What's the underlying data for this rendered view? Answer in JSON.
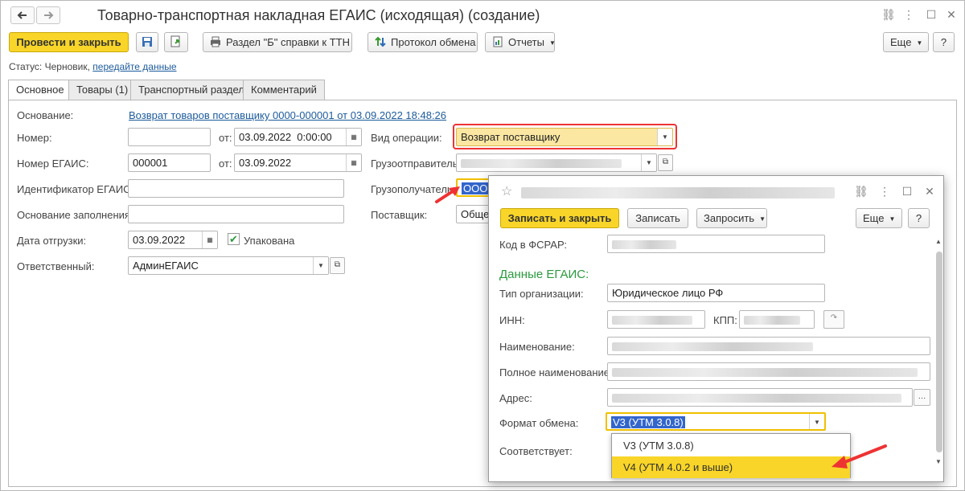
{
  "window": {
    "title": "Товарно-транспортная накладная ЕГАИС (исходящая) (создание)",
    "back_icon": "arrow-left-icon",
    "forward_icon": "arrow-right-icon"
  },
  "toolbar": {
    "post_close": "Провести и закрыть",
    "section_b": "Раздел \"Б\" справки к ТТН",
    "protocol": "Протокол обмена",
    "reports": "Отчеты",
    "more": "Еще",
    "help": "?"
  },
  "status": {
    "label": "Статус:",
    "value": "Черновик,",
    "link": "передайте данные"
  },
  "tabs": [
    "Основное",
    "Товары (1)",
    "Транспортный раздел",
    "Комментарий"
  ],
  "form": {
    "basis_label": "Основание:",
    "basis_link": "Возврат товаров поставщику 0000-000001 от 03.09.2022 18:48:26",
    "number_label": "Номер:",
    "number_value": "",
    "from_label": "от:",
    "date1": "03.09.2022  0:00:00",
    "egais_number_label": "Номер ЕГАИС:",
    "egais_number": "000001",
    "date2": "03.09.2022",
    "egais_id_label": "Идентификатор ЕГАИС:",
    "fill_basis_label": "Основание заполнения:",
    "ship_date_label": "Дата отгрузки:",
    "ship_date": "03.09.2022",
    "packed_label": "Упакована",
    "packed": true,
    "responsible_label": "Ответственный:",
    "responsible": "АдминЕГАИС",
    "op_type_label": "Вид операции:",
    "op_type": "Возврат поставщику",
    "shipper_label": "Грузоотправитель:",
    "consignee_label": "Грузополучатель:",
    "consignee_value": "ООО \"",
    "supplier_label": "Поставщик:",
    "supplier_value": "Общес"
  },
  "popup": {
    "save_close": "Записать и закрыть",
    "save": "Записать",
    "request": "Запросить",
    "more": "Еще",
    "help": "?",
    "fsrar_label": "Код в ФСРАР:",
    "section_title": "Данные ЕГАИС:",
    "org_type_label": "Тип организации:",
    "org_type": "Юридическое лицо РФ",
    "inn_label": "ИНН:",
    "kpp_label": "КПП:",
    "name_label": "Наименование:",
    "full_name_label": "Полное наименование:",
    "address_label": "Адрес:",
    "format_label": "Формат обмена:",
    "format_value": "V3 (УТМ 3.0.8)",
    "matches_label": "Соответствует:"
  },
  "dropdown_options": [
    "V3 (УТМ 3.0.8)",
    "V4 (УТМ 4.0.2 и выше)"
  ],
  "colors": {
    "primary": "#f8d528",
    "highlight": "#e33333",
    "link": "#1c5b9c",
    "section": "#2b9a3e"
  }
}
